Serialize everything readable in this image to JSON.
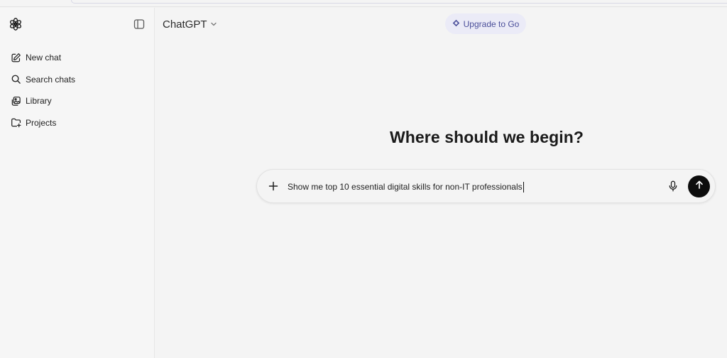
{
  "app": {
    "model_name": "ChatGPT",
    "upgrade_label": "Upgrade to Go"
  },
  "sidebar": {
    "items": [
      {
        "label": "New chat",
        "icon": "compose-icon"
      },
      {
        "label": "Search chats",
        "icon": "search-icon"
      },
      {
        "label": "Library",
        "icon": "images-icon"
      },
      {
        "label": "Projects",
        "icon": "folder-plus-icon"
      }
    ]
  },
  "main": {
    "headline": "Where should we begin?"
  },
  "composer": {
    "value": "Show me top 10 essential digital skills for non-IT professionals"
  },
  "colors": {
    "background": "#f4f4f4",
    "upgrade_bg": "#ebebf7",
    "upgrade_text": "#4b4f9a",
    "send_button": "#0d0d0d"
  }
}
